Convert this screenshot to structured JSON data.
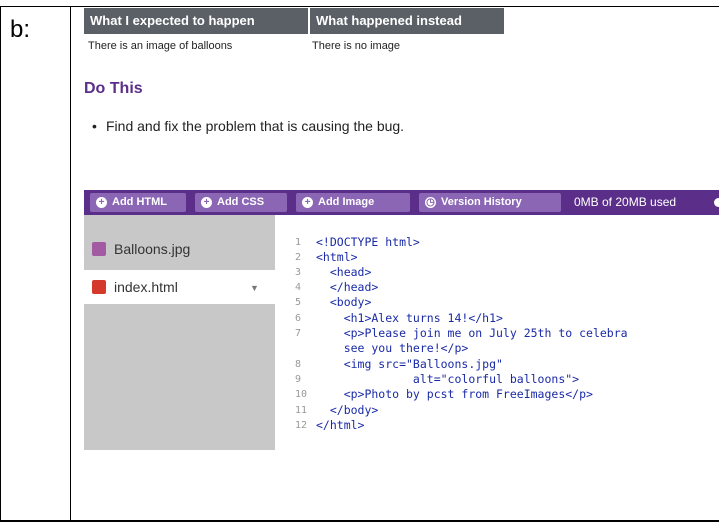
{
  "label": "b:",
  "expected_table": {
    "headers": [
      "What I expected to happen",
      "What happened instead"
    ],
    "row": [
      "There is an image of balloons",
      "There is no image"
    ]
  },
  "do_this": {
    "title": "Do This",
    "items": [
      "Find and fix the problem that is causing the bug."
    ]
  },
  "toolbar": {
    "buttons": [
      {
        "label": "Add HTML",
        "icon": "plus-circle-icon"
      },
      {
        "label": "Add CSS",
        "icon": "plus-circle-icon"
      },
      {
        "label": "Add Image",
        "icon": "plus-circle-icon"
      },
      {
        "label": "Version History",
        "icon": "clock-icon"
      }
    ],
    "usage": "0MB of 20MB used"
  },
  "files": [
    {
      "name": "Balloons.jpg",
      "icon": "image-file-icon",
      "icon_color": "#a25aa2",
      "active": false
    },
    {
      "name": "index.html",
      "icon": "pencil-file-icon",
      "icon_color": "#d33a2c",
      "active": true
    }
  ],
  "code_lines": [
    {
      "n": "1",
      "text": "<!DOCTYPE html>"
    },
    {
      "n": "2",
      "text": "<html>"
    },
    {
      "n": "3",
      "text": "  <head>"
    },
    {
      "n": "4",
      "text": "  </head>"
    },
    {
      "n": "5",
      "text": "  <body>"
    },
    {
      "n": "6",
      "text": "    <h1>Alex turns 14!</h1>"
    },
    {
      "n": "7",
      "text": "    <p>Please join me on July 25th to celebra"
    },
    {
      "n": "",
      "text": "    see you there!</p>"
    },
    {
      "n": "8",
      "text": "    <img src=\"Balloons.jpg\""
    },
    {
      "n": "9",
      "text": "              alt=\"colorful balloons\">"
    },
    {
      "n": "10",
      "text": "    <p>Photo by pcst from FreeImages</p>"
    },
    {
      "n": "11",
      "text": "  </body>"
    },
    {
      "n": "12",
      "text": "</html>"
    }
  ],
  "colors": {
    "toolbar": "#5b2f89",
    "button": "#8a66b5",
    "sidebar": "#c8c8c8",
    "header": "#5a6066"
  }
}
